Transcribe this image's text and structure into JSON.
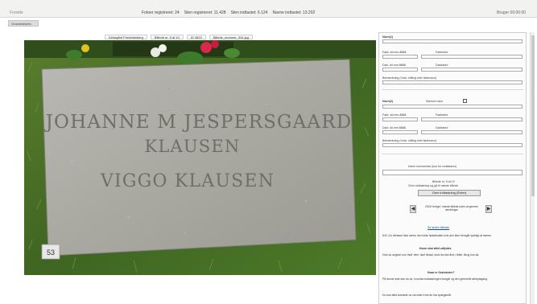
{
  "topbar": {
    "brand": "Forside",
    "stats": [
      "Fotoer registreret: 24",
      "Sten registreret: 11.428",
      "Sten indtastet: 6.124",
      "Navne indtastet: 13.202"
    ],
    "usertime": "Bruger 00:00:00"
  },
  "menu": {
    "tab": "Gravstedsinfo"
  },
  "image_header": [
    "Kirkegård Frederiksberg",
    "Billede nr. 5 af 10",
    "ID 4823",
    "Billede_nummer_944.jpg"
  ],
  "headstone": {
    "line1": "JOHANNE M JESPERSGAARD",
    "line2": "KLAUSEN",
    "line3": "VIGGO KLAUSEN",
    "tag": "53"
  },
  "form": {
    "person1_label": "Navn(1)",
    "born_date_label": "Født, dd.mm.åååå",
    "born_place_label": "Fødested",
    "death_date_label": "Død, dd.mm.åååå",
    "death_place_label": "Dødssted",
    "notes_label": "Bemærkning (f.eks. stilling eller fødenavn)",
    "person2_label": "Navn(2)",
    "same_name_label": "Samme navn",
    "born_date2_label": "Født, dd.mm.åååå",
    "born_place2_label": "Fødested",
    "death_date2_label": "Død, dd.mm.åååå",
    "death_place2_label": "Dødssted",
    "notes2_label": "Bemærkning (f.eks. stilling eller fødenavn)",
    "stone_comment_label": "Intern kommentar (kun for redaktører)",
    "counter": "Billede nr. 5 af 10",
    "counter_sub": "Gem indtastning og gå til næste billede",
    "save_button": "Gem indtastning (Enter)",
    "nav_text": "Gå til forrige / næste billede uden at gemme ændringer",
    "prev_arrow": "◀",
    "next_arrow": "▶",
    "link": "Se andre billeder",
    "help_heading": "Hvem skal altid udfyldes",
    "help_text1": "N.B. Du behøver ikke skrive den fulde fødselsdato hvis den ikke fremgår tydeligt af stenen.",
    "help_text2": "Hvis du angiver kun 'født' eller 'død' årstal, skriv da blot året i feltet. Brug kun tal.",
    "help_heading2": "Hvad er Gravsteder?",
    "help_text3": "På denne side kan du se, hvordan indtastningen foregår og den generelle arbejdsgang.",
    "help_text4": "Du kan altid kontakte os via siden hvis du har spørgsmål."
  }
}
